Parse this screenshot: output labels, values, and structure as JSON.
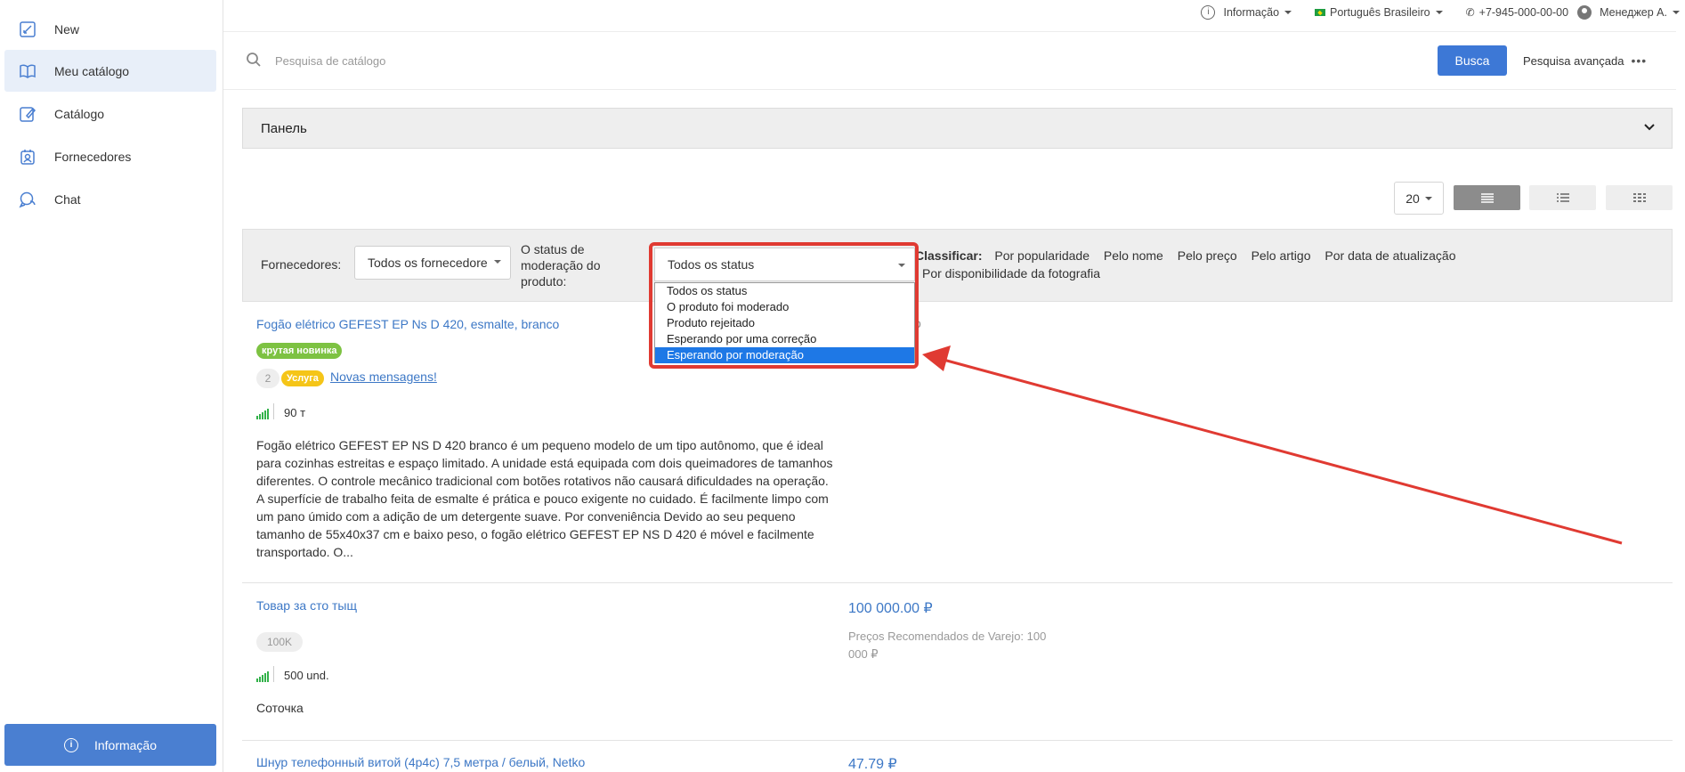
{
  "sidebar": {
    "items": [
      {
        "label": "New",
        "icon": "new-icon"
      },
      {
        "label": "Meu catálogo",
        "icon": "book-icon",
        "active": true
      },
      {
        "label": "Catálogo",
        "icon": "catalog-icon"
      },
      {
        "label": "Fornecedores",
        "icon": "suppliers-icon"
      },
      {
        "label": "Chat",
        "icon": "chat-icon"
      }
    ],
    "info_button": "Informação"
  },
  "topbar": {
    "info": "Informação",
    "language": "Português Brasileiro",
    "phone": "+7-945-000-00-00",
    "user": "Менеджер А."
  },
  "search": {
    "placeholder": "Pesquisa de catálogo",
    "button": "Busca",
    "advanced": "Pesquisa avançada"
  },
  "panel": {
    "title": "Панель"
  },
  "view": {
    "per_page": "20"
  },
  "filters": {
    "suppliers_label": "Fornecedores:",
    "suppliers_value": "Todos os fornecedore",
    "status_label_1": "O status de",
    "status_label_2": "moderação do",
    "status_label_3": "produto:",
    "status_value": "Todos os status",
    "status_options": [
      "Todos os status",
      "O produto foi moderado",
      "Produto rejeitado",
      "Esperando por uma correção",
      "Esperando por moderação"
    ],
    "status_selected_index": 4,
    "sort_label": "Classificar:",
    "sort_options_row1": [
      "Por popularidade",
      "Pelo nome",
      "Pelo preço",
      "Pelo artigo",
      "Por data de atualização"
    ],
    "sort_options_row2": [
      "Por disponibilidade da fotografia"
    ]
  },
  "products": [
    {
      "title": "Fogão elétrico GEFEST EP Ns D 420, esmalte, branco",
      "badge": "крутая новинка",
      "message_count": "2",
      "service_badge": "Услуга",
      "messages_link": "Novas mensagens!",
      "stock": "90 т",
      "description": "Fogão elétrico GEFEST EP NS D 420 branco é um pequeno modelo de um tipo autônomo, que é ideal para cozinhas estreitas e espaço limitado. A unidade está equipada com dois queimadores de tamanhos diferentes. O controle mecânico tradicional com botões rotativos não causará dificuldades na operação. A superfície de trabalho feita de esmalte é prática e pouco exigente no cuidado. É facilmente limpo com um pano úmido com a adição de um detergente suave. Por conveniência Devido ao seu pequeno tamanho de 55x40x37 cm e baixo peso, o fogão elétrico GEFEST EP NS D 420 é móvel e facilmente transportado. O..."
    },
    {
      "title": "Товар за сто тыщ",
      "tag": "100K",
      "stock": "500 und.",
      "note": "Соточка",
      "price": "100 000.00 ₽",
      "rrp_1": "Preços Recomendados de Varejo: 100",
      "rrp_2": "000 ₽"
    },
    {
      "title": "Шнур телефонный витой (4р4с) 7,5 метра / белый, Netko",
      "price": "47.79 ₽"
    }
  ],
  "colors": {
    "accent": "#3d78d6",
    "link": "#3d78c6",
    "highlight": "#e03a32",
    "selection": "#1e78e6",
    "badge_green": "#7dc242",
    "badge_yellow": "#f5c518"
  }
}
